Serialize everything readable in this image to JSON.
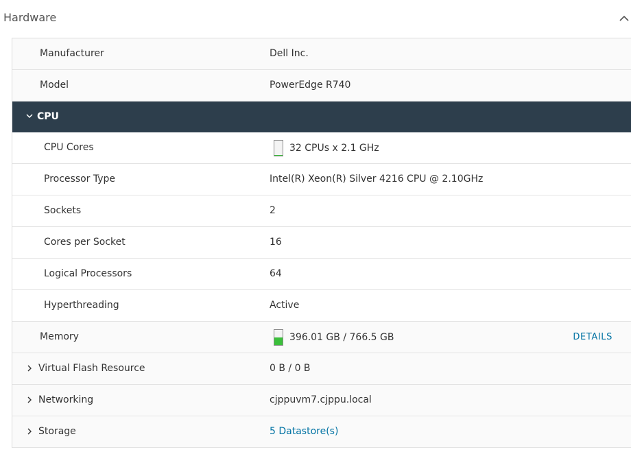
{
  "section": {
    "title": "Hardware",
    "collapse_icon": "chevron-up-icon"
  },
  "rows": {
    "manufacturer": {
      "label": "Manufacturer",
      "value": "Dell Inc."
    },
    "model": {
      "label": "Model",
      "value": "PowerEdge R740"
    }
  },
  "cpu": {
    "group_label": "CPU",
    "expand_icon": "chevron-down-icon",
    "cores": {
      "label": "CPU Cores",
      "value": "32 CPUs x 2.1 GHz",
      "usage_fraction": 0.05
    },
    "processor_type": {
      "label": "Processor Type",
      "value": "Intel(R) Xeon(R) Silver 4216 CPU @ 2.10GHz"
    },
    "sockets": {
      "label": "Sockets",
      "value": "2"
    },
    "cores_per_socket": {
      "label": "Cores per Socket",
      "value": "16"
    },
    "logical_processors": {
      "label": "Logical Processors",
      "value": "64"
    },
    "hyperthreading": {
      "label": "Hyperthreading",
      "value": "Active"
    }
  },
  "memory": {
    "label": "Memory",
    "value": "396.01 GB / 766.5 GB",
    "usage_fraction": 0.52,
    "details_label": "DETAILS"
  },
  "virtual_flash": {
    "label": "Virtual Flash Resource",
    "value": "0 B / 0 B"
  },
  "networking": {
    "label": "Networking",
    "value": "cjppuvm7.cjppu.local"
  },
  "storage": {
    "label": "Storage",
    "value": "5 Datastore(s)"
  },
  "colors": {
    "group_header_bg": "#2d3e4c",
    "link": "#0072a3",
    "meter_fill": "#3bbf3b"
  }
}
